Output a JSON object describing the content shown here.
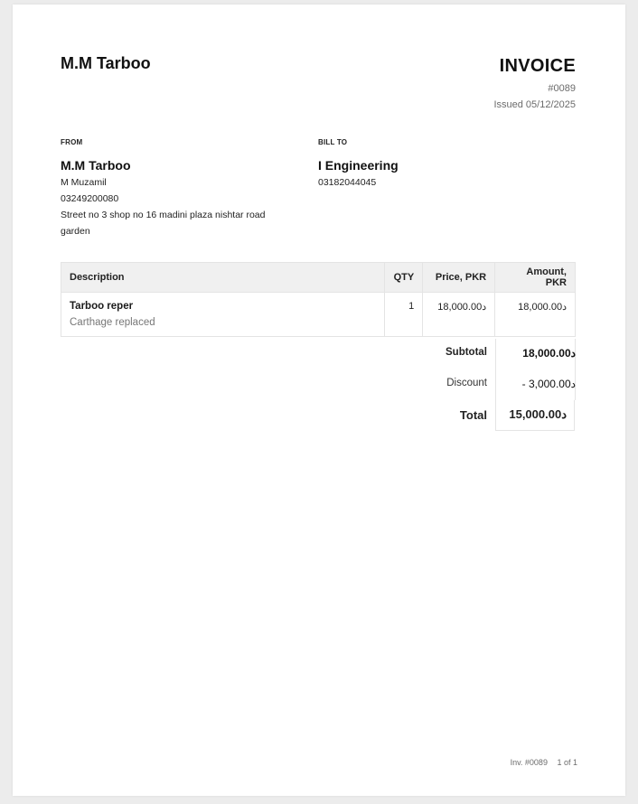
{
  "header": {
    "company": "M.M Tarboo",
    "doc_title": "INVOICE",
    "invoice_number": "#0089",
    "issued": "Issued 05/12/2025"
  },
  "from": {
    "label": "FROM",
    "name": "M.M Tarboo",
    "contact": "M Muzamil",
    "phone": "03249200080",
    "address": "Street no 3 shop no 16 madini plaza nishtar road garden"
  },
  "bill_to": {
    "label": "BILL TO",
    "name": "I Engineering",
    "phone": "03182044045"
  },
  "table": {
    "headers": {
      "description": "Description",
      "qty": "QTY",
      "price": "Price, PKR",
      "amount": "Amount, PKR"
    },
    "rows": [
      {
        "name": "Tarboo reper",
        "note": "Carthage replaced",
        "qty": "1",
        "price": "18,000.00‏د",
        "amount": "18,000.00‏د"
      }
    ]
  },
  "totals": {
    "subtotal_label": "Subtotal",
    "subtotal_value": "18,000.00‏د",
    "discount_label": "Discount",
    "discount_value": "- 3,000.00‏د",
    "total_label": "Total",
    "total_value": "15,000.00‏د"
  },
  "footer": {
    "ref": "Inv. #0089",
    "pages": "1 of 1"
  }
}
